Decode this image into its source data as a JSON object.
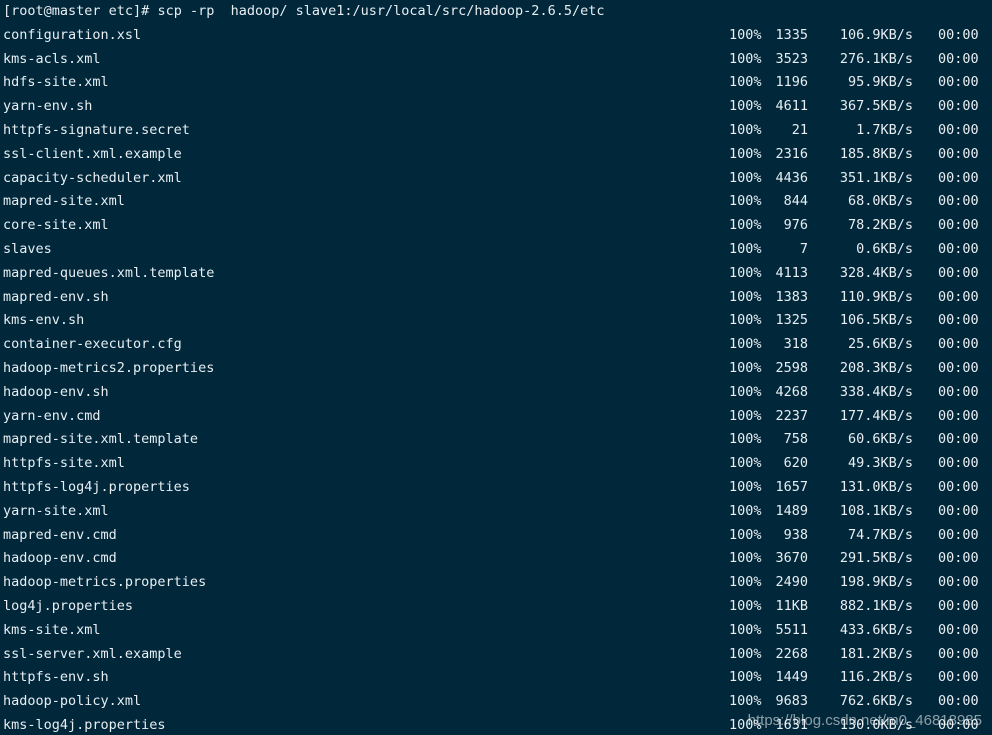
{
  "terminal": {
    "prompt": "[root@master etc]# ",
    "command": "scp -rp  hadoop/ slave1:/usr/local/src/hadoop-2.6.5/etc",
    "colors": {
      "background": "#00273a",
      "text": "#e8eef2"
    },
    "rows": [
      {
        "file": "configuration.xsl",
        "percent": "100%",
        "size": "1335",
        "rate": "106.9KB/s",
        "time": "00:00"
      },
      {
        "file": "kms-acls.xml",
        "percent": "100%",
        "size": "3523",
        "rate": "276.1KB/s",
        "time": "00:00"
      },
      {
        "file": "hdfs-site.xml",
        "percent": "100%",
        "size": "1196",
        "rate": "95.9KB/s",
        "time": "00:00"
      },
      {
        "file": "yarn-env.sh",
        "percent": "100%",
        "size": "4611",
        "rate": "367.5KB/s",
        "time": "00:00"
      },
      {
        "file": "httpfs-signature.secret",
        "percent": "100%",
        "size": "21",
        "rate": "1.7KB/s",
        "time": "00:00"
      },
      {
        "file": "ssl-client.xml.example",
        "percent": "100%",
        "size": "2316",
        "rate": "185.8KB/s",
        "time": "00:00"
      },
      {
        "file": "capacity-scheduler.xml",
        "percent": "100%",
        "size": "4436",
        "rate": "351.1KB/s",
        "time": "00:00"
      },
      {
        "file": "mapred-site.xml",
        "percent": "100%",
        "size": "844",
        "rate": "68.0KB/s",
        "time": "00:00"
      },
      {
        "file": "core-site.xml",
        "percent": "100%",
        "size": "976",
        "rate": "78.2KB/s",
        "time": "00:00"
      },
      {
        "file": "slaves",
        "percent": "100%",
        "size": "7",
        "rate": "0.6KB/s",
        "time": "00:00"
      },
      {
        "file": "mapred-queues.xml.template",
        "percent": "100%",
        "size": "4113",
        "rate": "328.4KB/s",
        "time": "00:00"
      },
      {
        "file": "mapred-env.sh",
        "percent": "100%",
        "size": "1383",
        "rate": "110.9KB/s",
        "time": "00:00"
      },
      {
        "file": "kms-env.sh",
        "percent": "100%",
        "size": "1325",
        "rate": "106.5KB/s",
        "time": "00:00"
      },
      {
        "file": "container-executor.cfg",
        "percent": "100%",
        "size": "318",
        "rate": "25.6KB/s",
        "time": "00:00"
      },
      {
        "file": "hadoop-metrics2.properties",
        "percent": "100%",
        "size": "2598",
        "rate": "208.3KB/s",
        "time": "00:00"
      },
      {
        "file": "hadoop-env.sh",
        "percent": "100%",
        "size": "4268",
        "rate": "338.4KB/s",
        "time": "00:00"
      },
      {
        "file": "yarn-env.cmd",
        "percent": "100%",
        "size": "2237",
        "rate": "177.4KB/s",
        "time": "00:00"
      },
      {
        "file": "mapred-site.xml.template",
        "percent": "100%",
        "size": "758",
        "rate": "60.6KB/s",
        "time": "00:00"
      },
      {
        "file": "httpfs-site.xml",
        "percent": "100%",
        "size": "620",
        "rate": "49.3KB/s",
        "time": "00:00"
      },
      {
        "file": "httpfs-log4j.properties",
        "percent": "100%",
        "size": "1657",
        "rate": "131.0KB/s",
        "time": "00:00"
      },
      {
        "file": "yarn-site.xml",
        "percent": "100%",
        "size": "1489",
        "rate": "108.1KB/s",
        "time": "00:00"
      },
      {
        "file": "mapred-env.cmd",
        "percent": "100%",
        "size": "938",
        "rate": "74.7KB/s",
        "time": "00:00"
      },
      {
        "file": "hadoop-env.cmd",
        "percent": "100%",
        "size": "3670",
        "rate": "291.5KB/s",
        "time": "00:00"
      },
      {
        "file": "hadoop-metrics.properties",
        "percent": "100%",
        "size": "2490",
        "rate": "198.9KB/s",
        "time": "00:00"
      },
      {
        "file": "log4j.properties",
        "percent": "100%",
        "size": "11KB",
        "rate": "882.1KB/s",
        "time": "00:00"
      },
      {
        "file": "kms-site.xml",
        "percent": "100%",
        "size": "5511",
        "rate": "433.6KB/s",
        "time": "00:00"
      },
      {
        "file": "ssl-server.xml.example",
        "percent": "100%",
        "size": "2268",
        "rate": "181.2KB/s",
        "time": "00:00"
      },
      {
        "file": "httpfs-env.sh",
        "percent": "100%",
        "size": "1449",
        "rate": "116.2KB/s",
        "time": "00:00"
      },
      {
        "file": "hadoop-policy.xml",
        "percent": "100%",
        "size": "9683",
        "rate": "762.6KB/s",
        "time": "00:00"
      },
      {
        "file": "kms-log4j.properties",
        "percent": "100%",
        "size": "1631",
        "rate": "130.0KB/s",
        "time": "00:00"
      }
    ]
  },
  "watermark": "https://blog.csdn.net/m0_46818985"
}
